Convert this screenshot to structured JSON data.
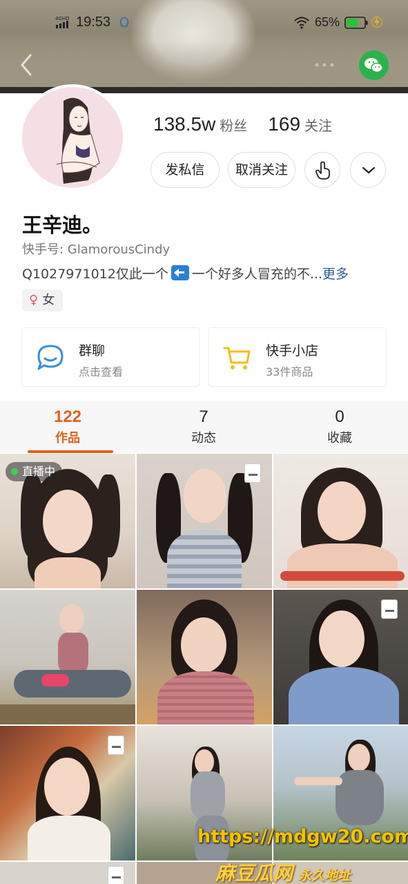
{
  "status_bar": {
    "network": "4G HD",
    "time": "19:53",
    "battery_percent": "65%",
    "battery_level": 0.65
  },
  "profile": {
    "fans_count": "138.5w",
    "fans_label": "粉丝",
    "following_count": "169",
    "following_label": "关注",
    "name": "王辛迪。",
    "kwai_id": "快手号: GlamorousCindy",
    "bio_prefix": "Q1027971012仅此一个",
    "bio_suffix": "一个好多人冒充的不...",
    "bio_more": "更多",
    "gender": "女"
  },
  "actions": {
    "message": "发私信",
    "unfollow": "取消关注"
  },
  "cards": {
    "group_chat": {
      "title": "群聊",
      "subtitle": "点击查看"
    },
    "shop": {
      "title": "快手小店",
      "subtitle": "33件商品"
    }
  },
  "tabs": [
    {
      "count": "122",
      "label": "作品"
    },
    {
      "count": "7",
      "label": "动态"
    },
    {
      "count": "0",
      "label": "收藏"
    }
  ],
  "grid": {
    "live_badge": "直播中"
  },
  "watermark": {
    "url": "https://mdgw20.com",
    "site": "麻豆瓜网",
    "tagline": "永久地址"
  },
  "colors": {
    "accent": "#e0621f",
    "wechat": "#2bb24d",
    "link": "#2e5a94"
  }
}
